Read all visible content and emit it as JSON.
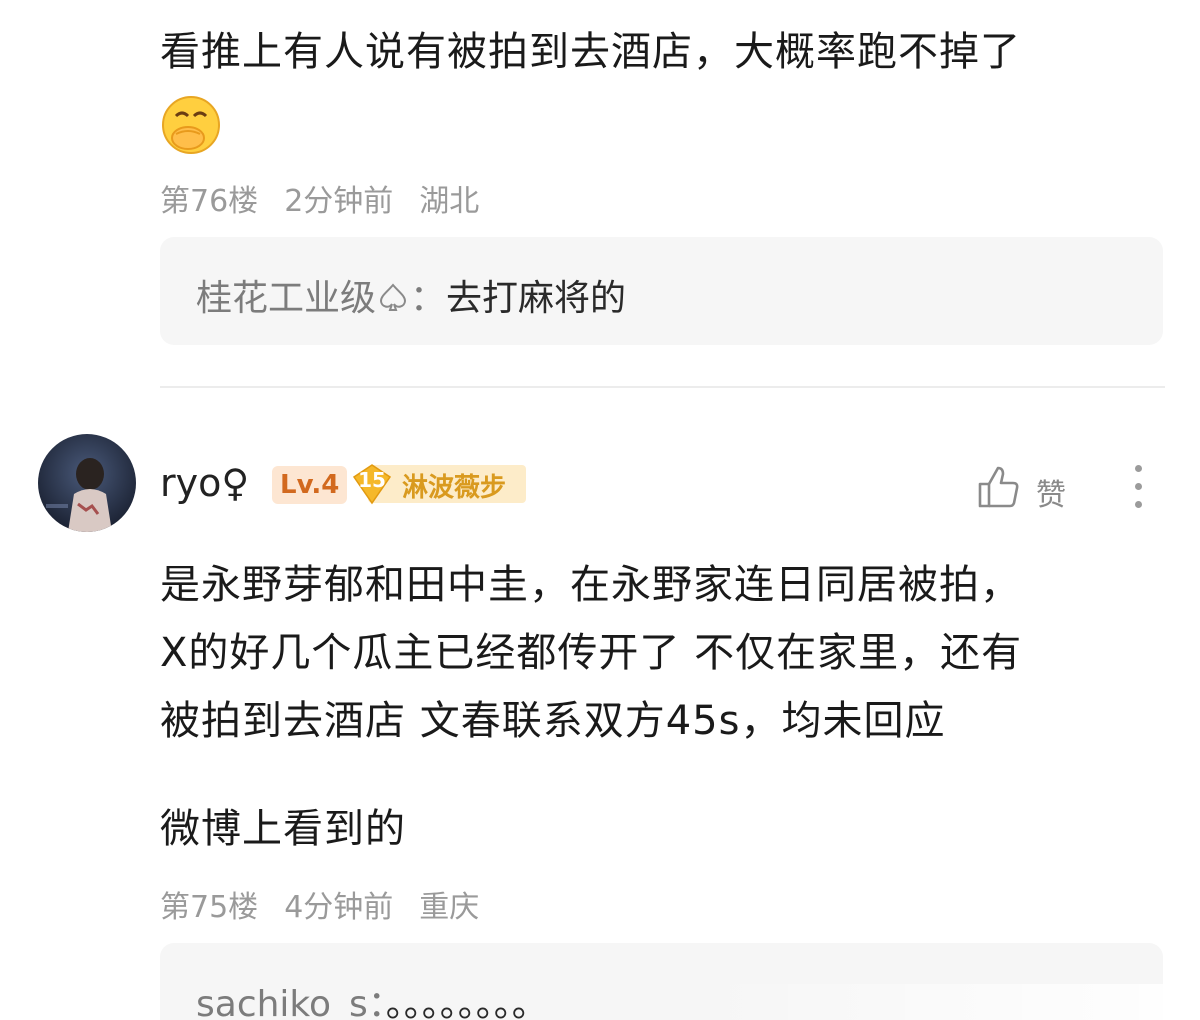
{
  "comment_top": {
    "text": "看推上有人说有被拍到去酒店，大概率跑不掉了",
    "emoji": "covering-mouth-face-emoji",
    "floor": "第76楼",
    "time": "2分钟前",
    "location": "湖北",
    "reply": {
      "user": "桂花工业级",
      "user_badge": "spade-icon",
      "separator": "：",
      "text": "去打麻将的"
    }
  },
  "comment_main": {
    "username": "ryo",
    "gender_symbol": "♀",
    "level": "Lv.4",
    "fan_level": "15",
    "fan_badge_name": "淋波薇步",
    "like_label": "赞",
    "lines": [
      "是永野芽郁和田中圭，在永野家连日同居被拍，",
      "X的好几个瓜主已经都传开了 不仅在家里，还有",
      "被拍到去酒店 文春联系双方45s，均未回应"
    ],
    "extra_line": "微博上看到的",
    "floor": "第75楼",
    "time": "4分钟前",
    "location": "重庆",
    "reply": {
      "user": "sachiko_s",
      "separator": "：",
      "text": "。。。。。。。。"
    }
  },
  "colors": {
    "meta": "#9a9a9a",
    "reply_bg": "#f6f6f6",
    "level_badge_bg": "#fde6d2",
    "level_badge_text": "#d2691e",
    "fan_badge_bg": "#fdecc9",
    "fan_badge_gem": "#f5b82a"
  }
}
